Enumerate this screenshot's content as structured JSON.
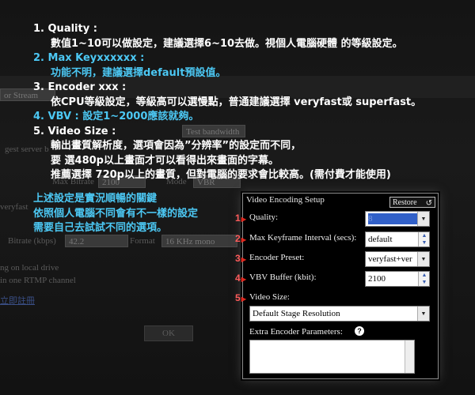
{
  "background": {
    "fields": [
      "or Stream",
      "Max Bitrate",
      "2100",
      "Test bandwidth",
      "Mode",
      "VBR",
      "Bitrate (kbps)",
      "42.2",
      "Format",
      "16 KHz mono"
    ],
    "texts": [
      "gest server b",
      "veryfast",
      "ng on local drive",
      "in one RTMP channel",
      "立即註冊"
    ],
    "ok_label": "OK"
  },
  "steps": [
    {
      "title": "1. Quality :",
      "desc": "數值1~10可以做設定，建議選擇6~10去做。視個人電腦硬體 的等級設定。",
      "cyan": false
    },
    {
      "title": "2. Max Keyxxxxxx :",
      "desc": "功能不明，建議選擇default預設值。",
      "cyan": true
    },
    {
      "title": "3. Encoder xxx :",
      "desc": "依CPU等級設定，等級高可以選慢點，普通建議選擇 veryfast或 superfast。",
      "cyan": false
    },
    {
      "title": "4. VBV : 設定1~2000應該就夠。",
      "desc": "",
      "cyan": true
    },
    {
      "title": "5. Video Size :",
      "desc": "",
      "cyan": false
    }
  ],
  "video_size_lines": [
    "輸出畫質解析度，選項會因為”分辨率”的設定而不同，",
    "要 選480p以上畫面才可以看得出來畫面的字幕。",
    "推薦選擇 720p以上的畫質，但對電腦的要求會比較高。(需付費才能使用)"
  ],
  "note_lines": [
    "上述設定是實況順暢的關鍵",
    "依照個人電腦不同會有不一樣的設定",
    "需要自己去試試不同的選項。"
  ],
  "panel": {
    "title": "Video Encoding Setup",
    "restore_label": "Restore",
    "quality": {
      "marker": "1",
      "label": "Quality:",
      "value": "8"
    },
    "keyframe": {
      "marker": "2",
      "label": "Max Keyframe Interval (secs):",
      "value": "default"
    },
    "preset": {
      "marker": "3",
      "label": "Encoder Preset:",
      "value": "veryfast+ver"
    },
    "vbv": {
      "marker": "4",
      "label": "VBV Buffer (kbit):",
      "value": "2100"
    },
    "video_size": {
      "marker": "5",
      "label": "Video Size:",
      "value": "Default Stage Resolution"
    },
    "extra": {
      "label": "Extra Encoder Parameters:",
      "help": "?"
    }
  },
  "colors": {
    "accent_cyan": "#4cc8f4",
    "marker_red": "#e0281e",
    "selection": "#3160c8"
  }
}
